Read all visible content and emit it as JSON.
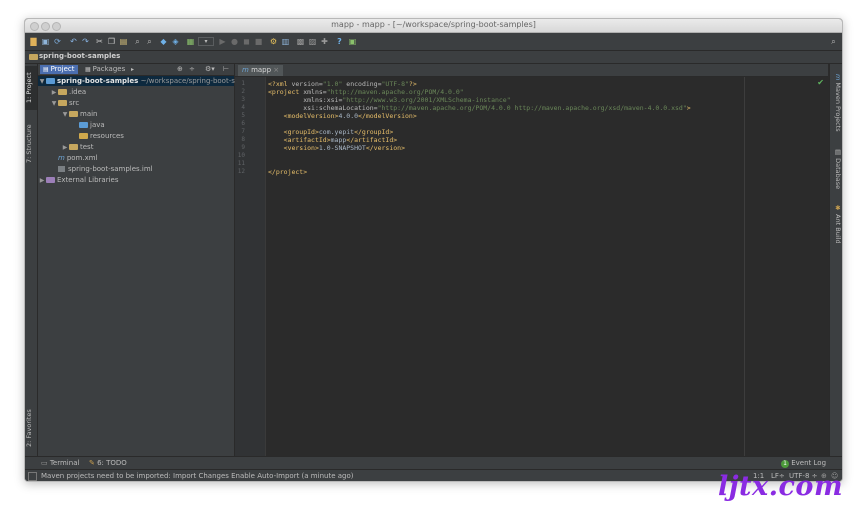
{
  "window": {
    "title": "mapp - mapp - [~/workspace/spring-boot-samples]"
  },
  "toolbar": {
    "icons": [
      "open-folder-icon",
      "save-icon",
      "sync-icon",
      "undo-icon",
      "redo-icon",
      "cut-icon",
      "copy-icon",
      "paste-icon",
      "find-icon",
      "replace-icon",
      "back-icon",
      "forward-icon",
      "make-icon",
      "run-config-dropdown",
      "run-icon",
      "debug-icon",
      "stop-icon",
      "coverage-icon",
      "settings-icon",
      "structure-icon",
      "sdk-icon",
      "trash-icon",
      "plugin-icon",
      "help-icon",
      "terminal-icon",
      "search-icon"
    ]
  },
  "breadcrumb": {
    "project": "spring-boot-samples"
  },
  "left_strip": {
    "project_tab": "1: Project",
    "structure_tab": "7: Structure",
    "favorites_tab": "2: Favorites"
  },
  "right_strip": {
    "maven_tab": "Maven Projects",
    "database_tab": "Database",
    "ant_tab": "Ant Build"
  },
  "project_panel": {
    "tab_project": "Project",
    "tab_packages": "Packages",
    "tree": [
      {
        "label": "spring-boot-samples",
        "suffix": "~/workspace/spring-boot-s",
        "indent": 0,
        "arrow": "▼",
        "icon": "module"
      },
      {
        "label": ".idea",
        "indent": 1,
        "arrow": "▶",
        "icon": "folder"
      },
      {
        "label": "src",
        "indent": 1,
        "arrow": "▼",
        "icon": "folder"
      },
      {
        "label": "main",
        "indent": 2,
        "arrow": "▼",
        "icon": "folder"
      },
      {
        "label": "java",
        "indent": 3,
        "arrow": "",
        "icon": "source-folder"
      },
      {
        "label": "resources",
        "indent": 3,
        "arrow": "",
        "icon": "resources-folder"
      },
      {
        "label": "test",
        "indent": 2,
        "arrow": "▶",
        "icon": "folder"
      },
      {
        "label": "pom.xml",
        "indent": 1,
        "arrow": "",
        "icon": "maven-file"
      },
      {
        "label": "spring-boot-samples.iml",
        "indent": 1,
        "arrow": "",
        "icon": "iml-file"
      },
      {
        "label": "External Libraries",
        "indent": 0,
        "arrow": "▶",
        "icon": "library"
      }
    ]
  },
  "editor": {
    "tab_label": "mapp",
    "line_numbers": [
      "1",
      "2",
      "3",
      "4",
      "5",
      "6",
      "7",
      "8",
      "9",
      "10",
      "11",
      "12"
    ],
    "lines": [
      [
        [
          "tag",
          "<?xml "
        ],
        [
          "attr",
          "version="
        ],
        [
          "str",
          "\"1.0\""
        ],
        [
          "attr",
          " encoding="
        ],
        [
          "str",
          "\"UTF-8\""
        ],
        [
          "tag",
          "?>"
        ]
      ],
      [
        [
          "tag",
          "<project "
        ],
        [
          "attr",
          "xmlns="
        ],
        [
          "str",
          "\"http://maven.apache.org/POM/4.0.0\""
        ]
      ],
      [
        [
          "attr",
          "         xmlns:xsi="
        ],
        [
          "str",
          "\"http://www.w3.org/2001/XMLSchema-instance\""
        ]
      ],
      [
        [
          "attr",
          "         xsi:schemaLocation="
        ],
        [
          "str",
          "\"http://maven.apache.org/POM/4.0.0 http://maven.apache.org/xsd/maven-4.0.0.xsd\""
        ],
        [
          "tag",
          ">"
        ]
      ],
      [
        [
          "tag",
          "    <modelVersion>"
        ],
        [
          "txt",
          "4.0.0"
        ],
        [
          "tag",
          "</modelVersion>"
        ]
      ],
      [],
      [
        [
          "tag",
          "    <groupId>"
        ],
        [
          "txt",
          "com.yepit"
        ],
        [
          "tag",
          "</groupId>"
        ]
      ],
      [
        [
          "tag",
          "    <artifactId>"
        ],
        [
          "txt",
          "mapp"
        ],
        [
          "tag",
          "</artifactId>"
        ]
      ],
      [
        [
          "tag",
          "    <version>"
        ],
        [
          "txt",
          "1.0-SNAPSHOT"
        ],
        [
          "tag",
          "</version>"
        ]
      ],
      [],
      [],
      [
        [
          "tag",
          "</project>"
        ]
      ]
    ]
  },
  "bottom_bar": {
    "terminal": "Terminal",
    "todo": "6: TODO",
    "event_log": "Event Log",
    "event_count": "1"
  },
  "status_bar": {
    "message": "Maven projects need to be imported: Import Changes Enable Auto-Import (a minute ago)",
    "position": "1:1",
    "line_sep": "LF÷",
    "encoding": "UTF-8 ÷"
  },
  "watermark": "ljtx.com",
  "colors": {
    "accent": "#4b6eaf",
    "tag": "#e8bf6a",
    "string": "#6a8759",
    "watermark": "#8a2be2"
  }
}
